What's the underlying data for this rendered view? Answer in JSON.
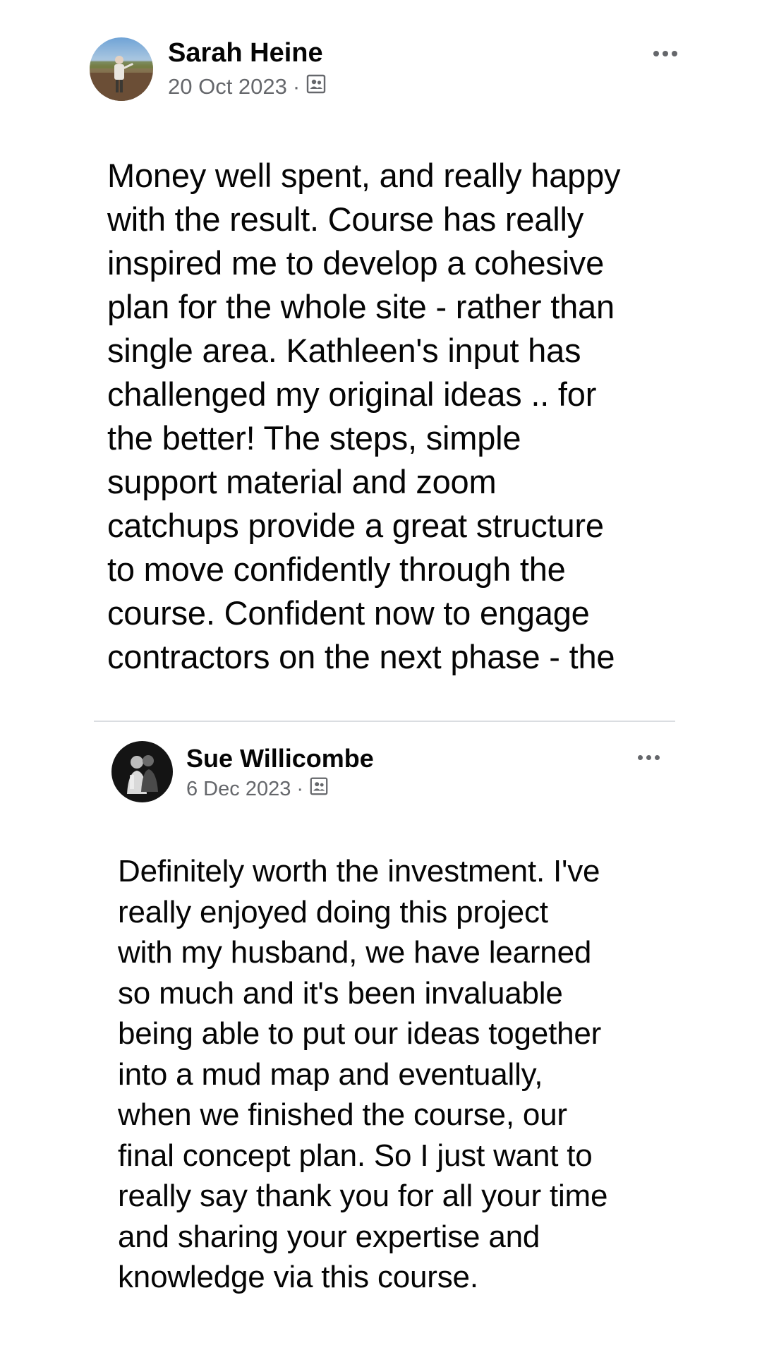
{
  "posts": [
    {
      "author": "Sarah Heine",
      "date": "20 Oct 2023",
      "separator": "·",
      "audience_icon": "friends-audience-icon",
      "more_icon": "more-options-icon",
      "lines": [
        "Money well spent, and really happy",
        "with the result. Course has really",
        "inspired me to develop a cohesive",
        "plan for the whole site - rather than",
        "single area. Kathleen's input has",
        "challenged my original ideas .. for",
        "the better! The steps, simple",
        "support material and zoom",
        "catchups provide a great structure",
        "to move confidently through the",
        "course. Confident now to engage",
        "contractors on the next phase - the"
      ]
    },
    {
      "author": "Sue Willicombe",
      "date": "6 Dec 2023",
      "separator": "·",
      "audience_icon": "friends-audience-icon",
      "more_icon": "more-options-icon",
      "lines": [
        "Definitely worth the investment. I've",
        "really enjoyed doing this project",
        "with my husband, we have learned",
        "so much and it's been invaluable",
        "being able to put our ideas together",
        "into a mud map and eventually,",
        "when we finished the course, our",
        "final concept plan. So I just want to",
        "really say thank you for all your time",
        "and sharing your expertise and",
        "knowledge via this course."
      ]
    }
  ],
  "colors": {
    "text": "#050505",
    "secondary": "#65676b",
    "divider": "#dadde1",
    "background": "#ffffff"
  }
}
